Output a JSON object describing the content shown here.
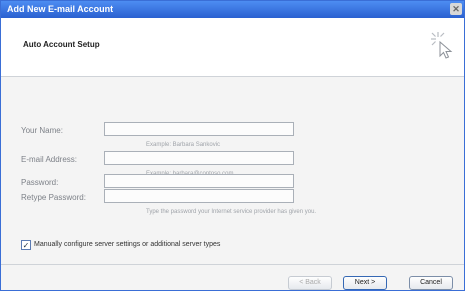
{
  "window": {
    "title": "Add New E-mail Account"
  },
  "header": {
    "section_title": "Auto Account Setup"
  },
  "form": {
    "your_name": {
      "label": "Your Name:",
      "hint": "Example: Barbara Sankovic"
    },
    "email_address": {
      "label": "E-mail Address:",
      "hint": "Example: barbara@contoso.com"
    },
    "password": {
      "label": "Password:"
    },
    "retype_password": {
      "label": "Retype Password:"
    },
    "password_hint": "Type the password your Internet service provider has given you."
  },
  "manual_config": {
    "checked": true,
    "label": "Manually configure server settings or additional server types"
  },
  "buttons": {
    "back": "< Back",
    "next": "Next >",
    "cancel": "Cancel"
  }
}
